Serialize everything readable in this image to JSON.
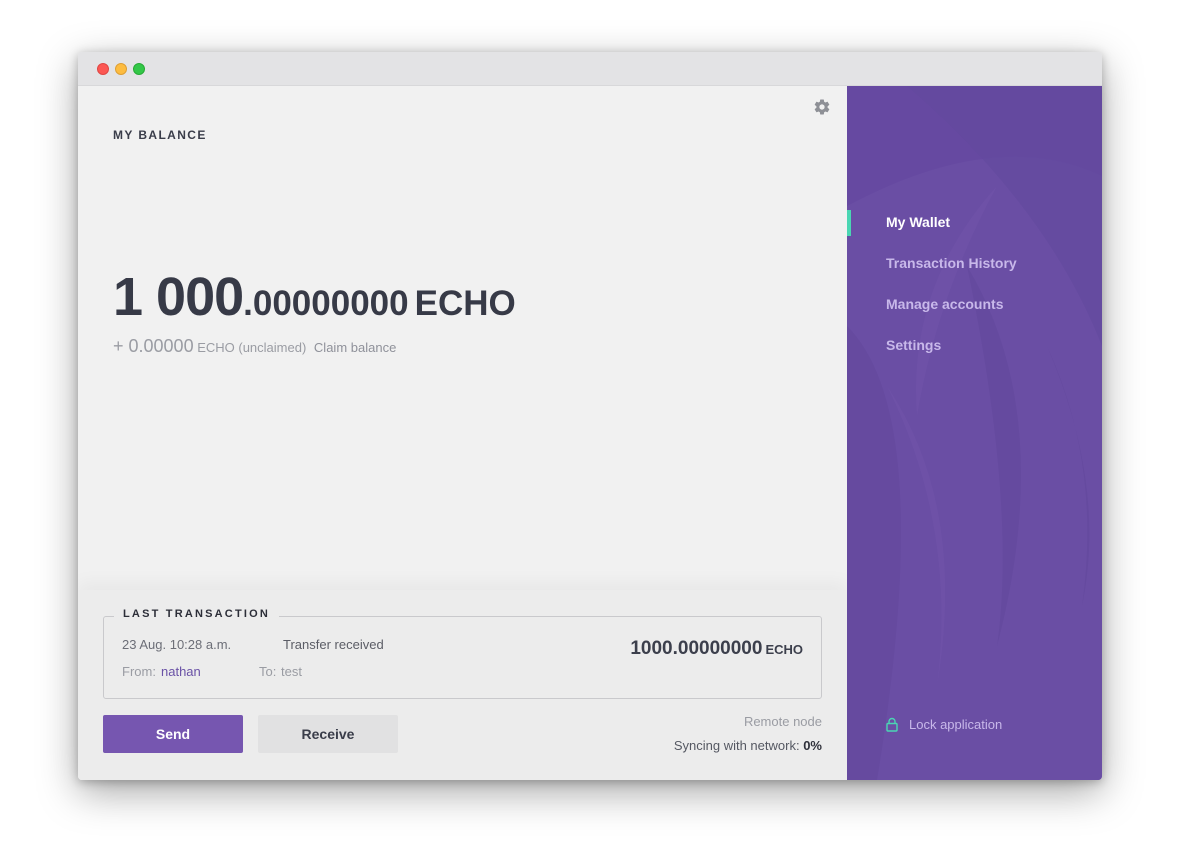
{
  "window": {
    "traffic_lights": [
      "close",
      "minimize",
      "maximize"
    ]
  },
  "main": {
    "settings_icon": "gear-icon",
    "balance": {
      "heading": "MY BALANCE",
      "integer": "1 000",
      "decimal": ".00000000",
      "currency": "ECHO",
      "unclaimed_value": "+ 0.00000",
      "unclaimed_label": "ECHO (unclaimed)",
      "claim_link": "Claim balance"
    },
    "last_transaction": {
      "title": "LAST TRANSACTION",
      "date": "23 Aug. 10:28 a.m.",
      "type": "Transfer received",
      "from_label": "From:",
      "from_value": "nathan",
      "to_label": "To:",
      "to_value": "test",
      "amount": "1000.00000000",
      "currency": "ECHO"
    },
    "actions": {
      "send_label": "Send",
      "receive_label": "Receive"
    },
    "status": {
      "node": "Remote node",
      "sync_label": "Syncing with network:",
      "sync_value": "0%"
    }
  },
  "sidebar": {
    "items": [
      {
        "label": "My Wallet",
        "active": true
      },
      {
        "label": "Transaction History",
        "active": false
      },
      {
        "label": "Manage accounts",
        "active": false
      },
      {
        "label": "Settings",
        "active": false
      }
    ],
    "lock_label": "Lock application",
    "lock_icon": "lock-icon"
  },
  "colors": {
    "accent_purple": "#7656b0",
    "sidebar_purple": "#6a4ea4",
    "active_indicator": "#4ad6b3",
    "link_purple": "#6a52a6"
  }
}
